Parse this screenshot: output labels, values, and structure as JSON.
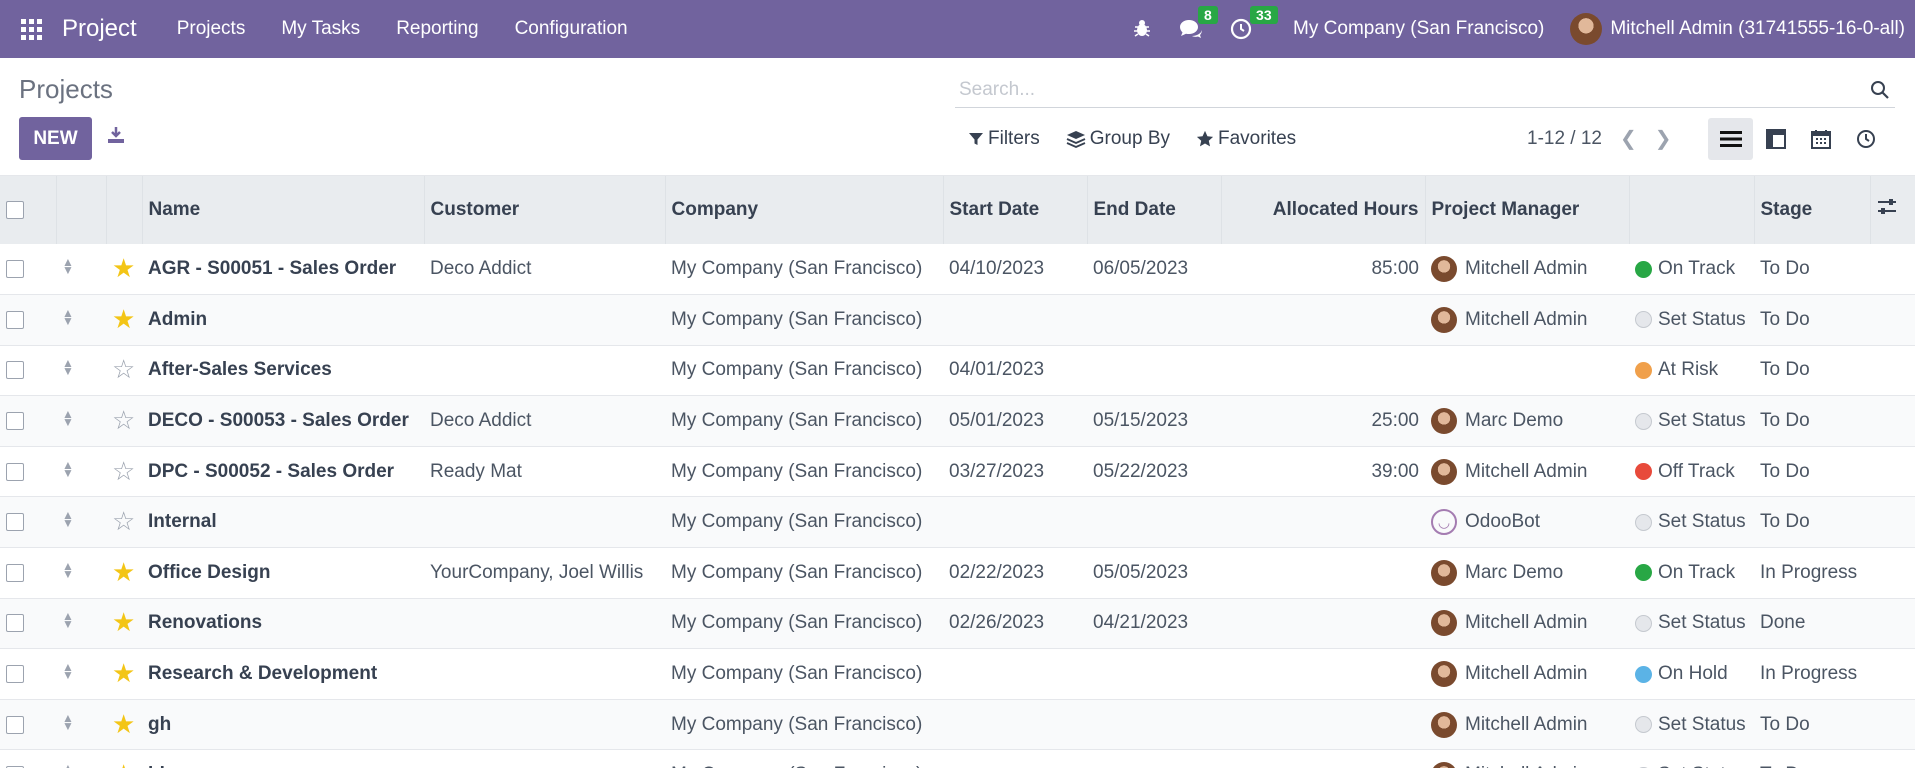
{
  "nav": {
    "brand": "Project",
    "menu": [
      "Projects",
      "My Tasks",
      "Reporting",
      "Configuration"
    ],
    "messages_count": "8",
    "activities_count": "33",
    "company": "My Company (San Francisco)",
    "user": "Mitchell Admin (31741555-16-0-all)"
  },
  "control": {
    "breadcrumb": "Projects",
    "new_label": "NEW",
    "search_placeholder": "Search...",
    "filters_label": "Filters",
    "groupby_label": "Group By",
    "favorites_label": "Favorites",
    "pager": "1-12 / 12"
  },
  "table": {
    "headers": [
      "Name",
      "Customer",
      "Company",
      "Start Date",
      "End Date",
      "Allocated Hours",
      "Project Manager",
      "",
      "Stage"
    ],
    "rows": [
      {
        "fav": true,
        "name": "AGR - S00051 - Sales Order",
        "customer": "Deco Addict",
        "company": "My Company (San Francisco)",
        "start": "04/10/2023",
        "end": "06/05/2023",
        "hours": "85:00",
        "manager": "Mitchell Admin",
        "mgr_type": "mitchell",
        "status": "On Track",
        "status_color": "#28a745",
        "stage": "To Do"
      },
      {
        "fav": true,
        "name": "Admin",
        "customer": "",
        "company": "My Company (San Francisco)",
        "start": "",
        "end": "",
        "hours": "",
        "manager": "Mitchell Admin",
        "mgr_type": "mitchell",
        "status": "Set Status",
        "status_color": "#e5e7eb",
        "stage": "To Do"
      },
      {
        "fav": false,
        "name": "After-Sales Services",
        "customer": "",
        "company": "My Company (San Francisco)",
        "start": "04/01/2023",
        "end": "",
        "hours": "",
        "manager": "",
        "mgr_type": "",
        "status": "At Risk",
        "status_color": "#f0a04b",
        "stage": "To Do"
      },
      {
        "fav": false,
        "name": "DECO - S00053 - Sales Order",
        "customer": "Deco Addict",
        "company": "My Company (San Francisco)",
        "start": "05/01/2023",
        "end": "05/15/2023",
        "hours": "25:00",
        "manager": "Marc Demo",
        "mgr_type": "marc",
        "status": "Set Status",
        "status_color": "#e5e7eb",
        "stage": "To Do"
      },
      {
        "fav": false,
        "name": "DPC - S00052 - Sales Order",
        "customer": "Ready Mat",
        "company": "My Company (San Francisco)",
        "start": "03/27/2023",
        "end": "05/22/2023",
        "hours": "39:00",
        "manager": "Mitchell Admin",
        "mgr_type": "mitchell",
        "status": "Off Track",
        "status_color": "#e84a3b",
        "stage": "To Do"
      },
      {
        "fav": false,
        "name": "Internal",
        "customer": "",
        "company": "My Company (San Francisco)",
        "start": "",
        "end": "",
        "hours": "",
        "manager": "OdooBot",
        "mgr_type": "bot",
        "status": "Set Status",
        "status_color": "#e5e7eb",
        "stage": "To Do"
      },
      {
        "fav": true,
        "name": "Office Design",
        "customer": "YourCompany, Joel Willis",
        "company": "My Company (San Francisco)",
        "start": "02/22/2023",
        "end": "05/05/2023",
        "hours": "",
        "manager": "Marc Demo",
        "mgr_type": "marc",
        "status": "On Track",
        "status_color": "#28a745",
        "stage": "In Progress"
      },
      {
        "fav": true,
        "name": "Renovations",
        "customer": "",
        "company": "My Company (San Francisco)",
        "start": "02/26/2023",
        "end": "04/21/2023",
        "hours": "",
        "manager": "Mitchell Admin",
        "mgr_type": "mitchell",
        "status": "Set Status",
        "status_color": "#e5e7eb",
        "stage": "Done"
      },
      {
        "fav": true,
        "name": "Research & Development",
        "customer": "",
        "company": "My Company (San Francisco)",
        "start": "",
        "end": "",
        "hours": "",
        "manager": "Mitchell Admin",
        "mgr_type": "mitchell",
        "status": "On Hold",
        "status_color": "#5bb3e6",
        "stage": "In Progress"
      },
      {
        "fav": true,
        "name": "gh",
        "customer": "",
        "company": "My Company (San Francisco)",
        "start": "",
        "end": "",
        "hours": "",
        "manager": "Mitchell Admin",
        "mgr_type": "mitchell",
        "status": "Set Status",
        "status_color": "#e5e7eb",
        "stage": "To Do"
      },
      {
        "fav": true,
        "name": "hh",
        "customer": "",
        "company": "My Company (San Francisco)",
        "start": "",
        "end": "",
        "hours": "",
        "manager": "Mitchell Admin",
        "mgr_type": "mitchell",
        "status": "Set Status",
        "status_color": "#e5e7eb",
        "stage": "To Do"
      }
    ]
  },
  "colors": {
    "brand": "#71639e",
    "star": "#f3c516"
  }
}
